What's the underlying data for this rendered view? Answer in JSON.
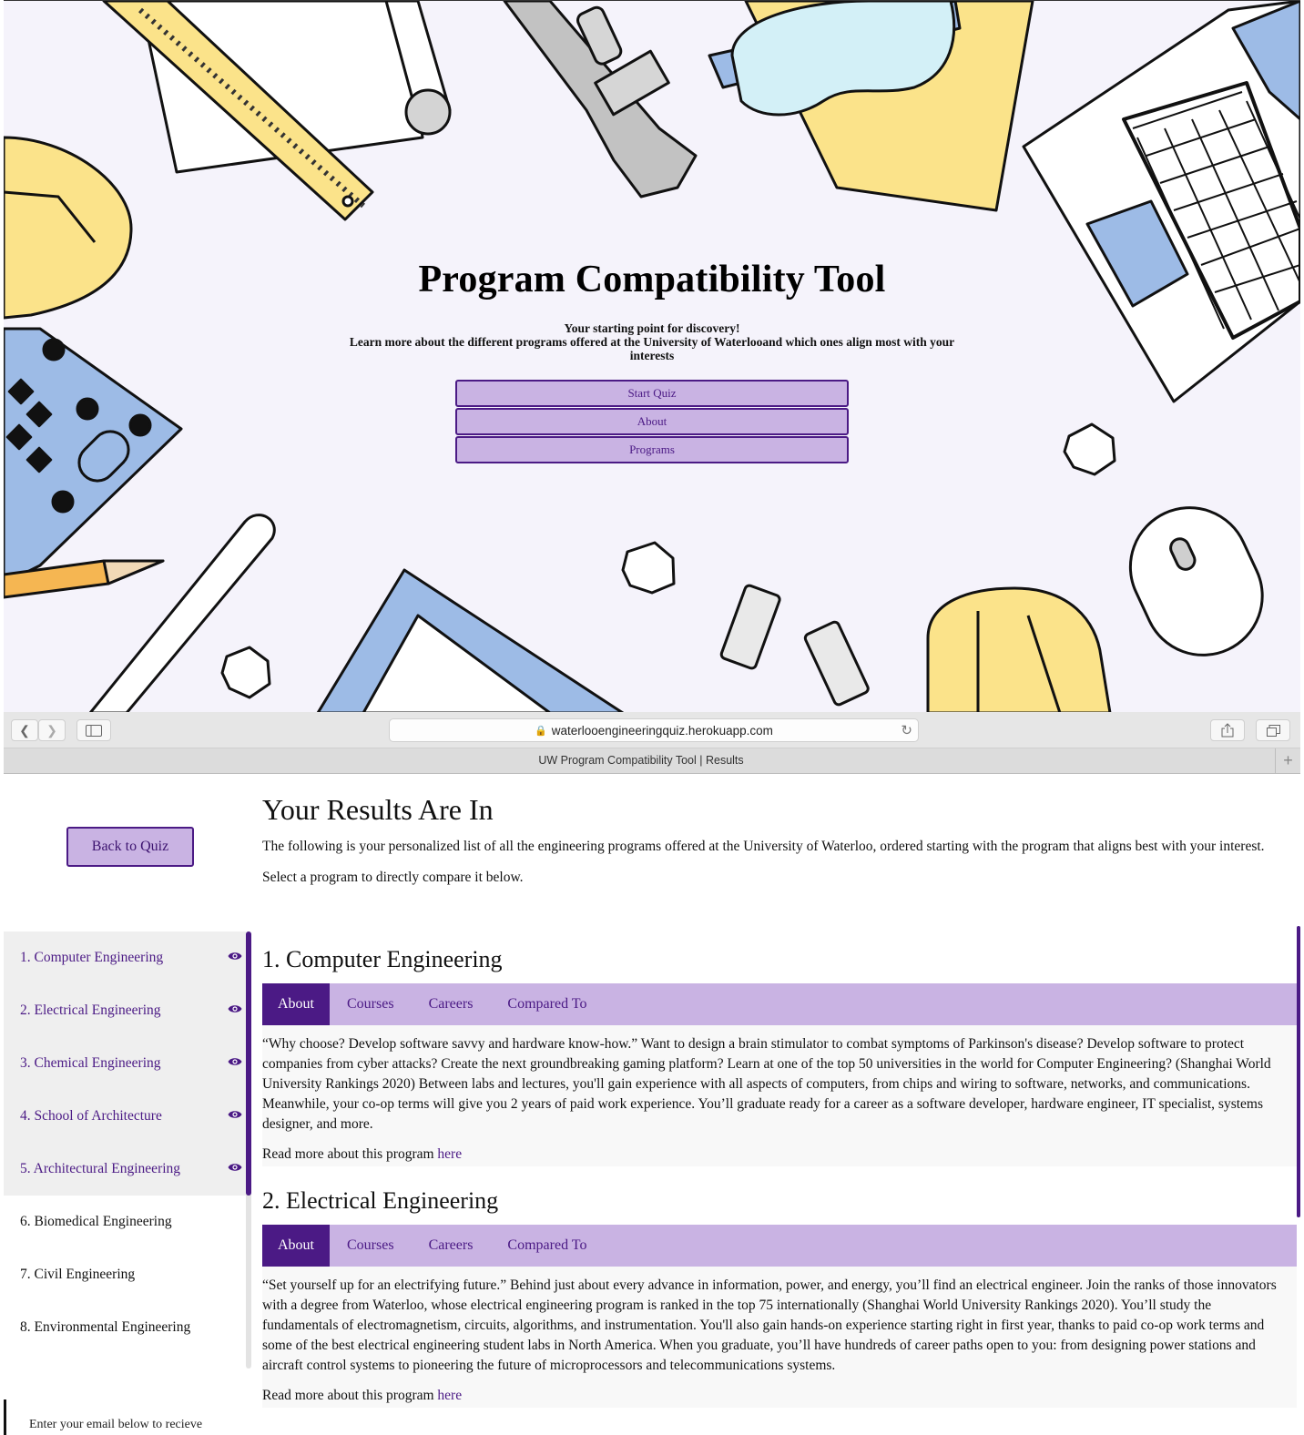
{
  "hero": {
    "title": "Program Compatibility Tool",
    "tagline": "Your starting point for discovery!",
    "description": "Learn more about the different programs offered at the University of Waterlooand which ones align most with your interests",
    "buttons": [
      "Start Quiz",
      "About",
      "Programs"
    ]
  },
  "browser": {
    "url": "waterlooengineeringquiz.herokuapp.com",
    "tab_title": "UW Program Compatibility Tool | Results"
  },
  "results": {
    "back_button": "Back to Quiz",
    "title": "Your Results Are In",
    "intro": "The following is your personalized list of all the engineering programs offered at the University of Waterloo, ordered starting with the program that aligns best with your interest.",
    "select_prompt": "Select a program to directly compare it below.",
    "sidebar": [
      {
        "label": "1. Computer Engineering",
        "selected": true
      },
      {
        "label": "2. Electrical Engineering",
        "selected": true
      },
      {
        "label": "3. Chemical Engineering",
        "selected": true
      },
      {
        "label": "4. School of Architecture",
        "selected": true
      },
      {
        "label": "5. Architectural Engineering",
        "selected": true
      },
      {
        "label": "6. Biomedical Engineering",
        "selected": false
      },
      {
        "label": "7. Civil Engineering",
        "selected": false
      },
      {
        "label": "8. Environmental Engineering",
        "selected": false
      }
    ],
    "tabs": [
      "About",
      "Courses",
      "Careers",
      "Compared To"
    ],
    "read_more_prefix": "Read more about this program ",
    "read_more_link": "here",
    "programs": [
      {
        "title": "1. Computer Engineering",
        "about": "“Why choose? Develop software savvy and hardware know-how.” Want to design a brain stimulator to combat symptoms of Parkinson's disease? Develop software to protect companies from cyber attacks? Create the next groundbreaking gaming platform? Learn at one of the top 50 universities in the world for Computer Engineering? (Shanghai World University Rankings 2020) Between labs and lectures, you'll gain experience with all aspects of computers, from chips and wiring to software, networks, and communications. Meanwhile, your co-op terms will give you 2 years of paid work experience. You’ll graduate ready for a career as a software developer, hardware engineer, IT specialist, systems designer, and more."
      },
      {
        "title": "2. Electrical Engineering",
        "about": "“Set yourself up for an electrifying future.” Behind just about every advance in information, power, and energy, you’ll find an electrical engineer. Join the ranks of those innovators with a degree from Waterloo, whose electrical engineering program is ranked in the top 75 internationally (Shanghai World University Rankings 2020). You’ll study the fundamentals of electromagnetism, circuits, algorithms, and instrumentation. You'll also gain hands-on experience starting right in first year, thanks to paid co-op work terms and some of the best electrical engineering student labs in North America. When you graduate, you’ll have hundreds of career paths open to you: from designing power stations and aircraft control systems to pioneering the future of microprocessors and telecommunications systems."
      }
    ],
    "email_hint": "Enter your email below to recieve"
  },
  "colors": {
    "accent": "#4b1a85",
    "accent_light": "#c9b3e3",
    "hero_bg": "#f5f3fb",
    "yellow": "#fbe38a",
    "blue": "#9dbbe6"
  }
}
